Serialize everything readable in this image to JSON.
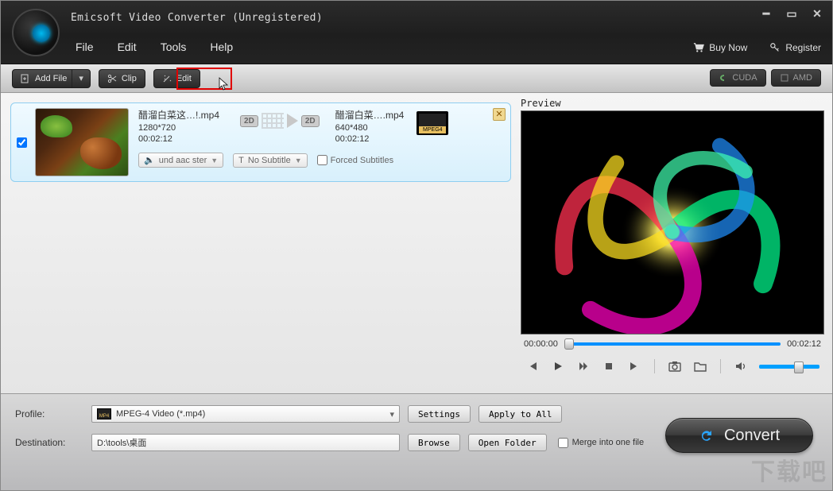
{
  "window": {
    "title": "Emicsoft Video Converter (Unregistered)"
  },
  "menu": {
    "file": "File",
    "edit": "Edit",
    "tools": "Tools",
    "help": "Help"
  },
  "header_links": {
    "buy": "Buy Now",
    "register": "Register"
  },
  "toolbar": {
    "add_file": "Add File",
    "clip": "Clip",
    "edit": "Edit",
    "cuda": "CUDA",
    "amd": "AMD"
  },
  "file_item": {
    "src": {
      "name": "醋溜白菜这…!.mp4",
      "res": "1280*720",
      "dur": "00:02:12"
    },
    "dst": {
      "name": "醋溜白菜….mp4",
      "res": "640*480",
      "dur": "00:02:12"
    },
    "badge2d": "2D",
    "audio_label": "und aac ster",
    "subtitle_label": "No Subtitle",
    "forced_label": "Forced Subtitles"
  },
  "preview": {
    "label": "Preview",
    "time_cur": "00:00:00",
    "time_total": "00:02:12"
  },
  "footer": {
    "profile_label": "Profile:",
    "profile_value": "MPEG-4 Video (*.mp4)",
    "settings": "Settings",
    "apply_all": "Apply to All",
    "destination_label": "Destination:",
    "destination_value": "D:\\tools\\桌面",
    "browse": "Browse",
    "open_folder": "Open Folder",
    "merge": "Merge into one file",
    "convert": "Convert"
  },
  "watermark": "下载吧"
}
